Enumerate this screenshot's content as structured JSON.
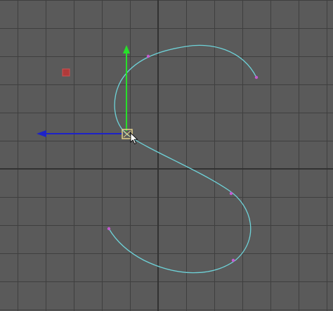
{
  "viewport": {
    "kind": "3D modeling viewport (orthographic view)",
    "background_color": "#5a5a5a",
    "grid_line_color": "#3f3f3f",
    "grid_axis_line_color": "#303030"
  },
  "curve": {
    "color": "#6ed2d8",
    "cv_color": "#c45ad0",
    "shape": "S-shaped NURBS curve with edit points"
  },
  "manipulator": {
    "tool": "move",
    "y_axis_color": "#27e02a",
    "x_axis_color": "#1d22c8",
    "center_color": "#e2d08a"
  },
  "marker": {
    "color": "#b03a3a",
    "shape": "small square"
  },
  "cursor": {
    "type": "arrow-pointer"
  }
}
